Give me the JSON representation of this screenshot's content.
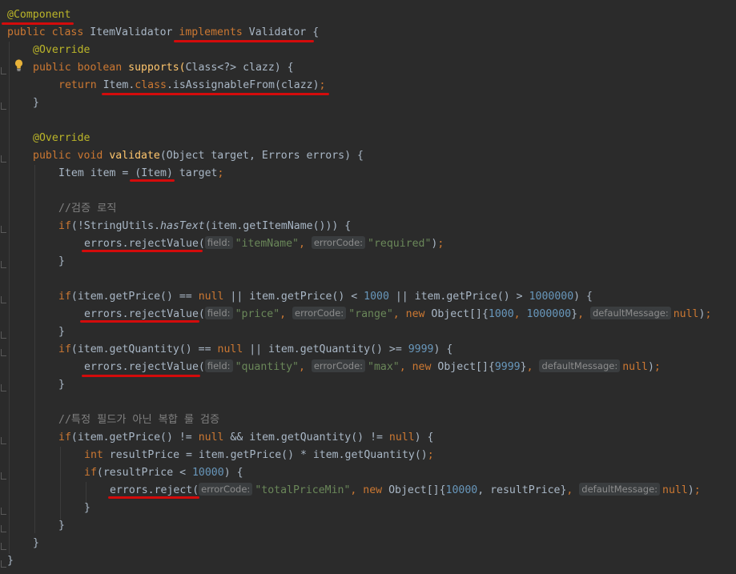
{
  "code": {
    "l1": {
      "annotation": "@Component"
    },
    "l2": {
      "kw1": "public",
      "kw2": "class",
      "name": "ItemValidator",
      "kw3": "implements",
      "iface": "Validator",
      "brace": " {"
    },
    "l3": {
      "annotation": "@Override"
    },
    "l4": {
      "kw1": "public",
      "kw2": "boolean",
      "fn": "supports",
      "paren": "(",
      "rest": "Class<?> clazz) {"
    },
    "l5": {
      "kw": "return",
      "pre": " Item.",
      "kw2": "class",
      "rest": ".isAssignableFrom(clazz)",
      "semi": ";"
    },
    "l6": {
      "text": "}"
    },
    "l7": {
      "annotation": "@Override"
    },
    "l8": {
      "kw1": "public",
      "kw2": "void",
      "fn": "validate",
      "rest": "(Object target, Errors errors) {"
    },
    "l9": {
      "pre": "Item item = ",
      "cast": "(Item)",
      "post": " target",
      "semi": ";"
    },
    "l10": {
      "comment": "//검증 로직"
    },
    "l11": {
      "kw": "if",
      "pre": "(!StringUtils.",
      "italic": "hasText",
      "post": "(item.getItemName())) {"
    },
    "l12": {
      "call": "errors.rejectValue(",
      "hint1": "field:",
      "arg1": "\"itemName\"",
      "sep1": ", ",
      "hint2": "errorCode:",
      "arg2": "\"required\"",
      "end": ")",
      "semi": ";"
    },
    "l13": {
      "text": "}"
    },
    "l14": {
      "kw": "if",
      "p1": "(item.getPrice() == ",
      "null1": "null",
      "p2": " || item.getPrice() < ",
      "n1": "1000",
      "p3": " || item.getPrice() > ",
      "n2": "1000000",
      "p4": ") {"
    },
    "l15": {
      "call": "errors.rejectValue(",
      "hint1": "field:",
      "arg1": "\"price\"",
      "sep1": ", ",
      "hint2": "errorCode:",
      "arg2": "\"range\"",
      "sep2": ", ",
      "kwnew": "new",
      "obj": " Object[]{",
      "n1": "1000",
      "sep3": ", ",
      "n2": "1000000",
      "close": "}",
      "sep4": ", ",
      "hint3": "defaultMessage:",
      "kwnull": "null",
      "end": ")",
      "semi": ";"
    },
    "l16": {
      "text": "}"
    },
    "l17": {
      "kw": "if",
      "p1": "(item.getQuantity() == ",
      "null1": "null",
      "p2": " || item.getQuantity() >= ",
      "n1": "9999",
      "p3": ") {"
    },
    "l18": {
      "call": "errors.rejectValue(",
      "hint1": "field:",
      "arg1": "\"quantity\"",
      "sep1": ", ",
      "hint2": "errorCode:",
      "arg2": "\"max\"",
      "sep2": ", ",
      "kwnew": "new",
      "obj": " Object[]{",
      "n1": "9999",
      "close": "}",
      "sep3": ", ",
      "hint3": "defaultMessage:",
      "kwnull": "null",
      "end": ")",
      "semi": ";"
    },
    "l19": {
      "text": "}"
    },
    "l20": {
      "comment": "//특정 필드가 아닌 복합 룰 검증"
    },
    "l21": {
      "kw": "if",
      "p1": "(item.getPrice() != ",
      "null1": "null",
      "p2": " && item.getQuantity() != ",
      "null2": "null",
      "p3": ") {"
    },
    "l22": {
      "kw": "int",
      "rest": " resultPrice = item.getPrice() * item.getQuantity()",
      "semi": ";"
    },
    "l23": {
      "kw": "if",
      "p1": "(resultPrice < ",
      "n1": "10000",
      "p2": ") {"
    },
    "l24": {
      "call": "errors.reject(",
      "hint1": "errorCode:",
      "arg1": "\"totalPriceMin\"",
      "sep1": ", ",
      "kwnew": "new",
      "obj": " Object[]{",
      "n1": "10000",
      "sep2": ", resultPrice}",
      "sep3": ", ",
      "hint2": "defaultMessage:",
      "kwnull": "null",
      "end": ")",
      "semi": ";"
    },
    "l25": {
      "text": "}"
    },
    "l26": {
      "text": "}"
    },
    "l27": {
      "text": "}"
    },
    "l28": {
      "text": "}"
    }
  },
  "icons": {
    "bulb": "lightbulb-icon",
    "fold": "fold-marker-icon"
  },
  "colors": {
    "background": "#2b2b2b",
    "keyword": "#cc7832",
    "annotation": "#bbb529",
    "string": "#6a8759",
    "number": "#6897bb",
    "method": "#ffc66d",
    "comment": "#808080",
    "underline": "#d40b0b"
  }
}
